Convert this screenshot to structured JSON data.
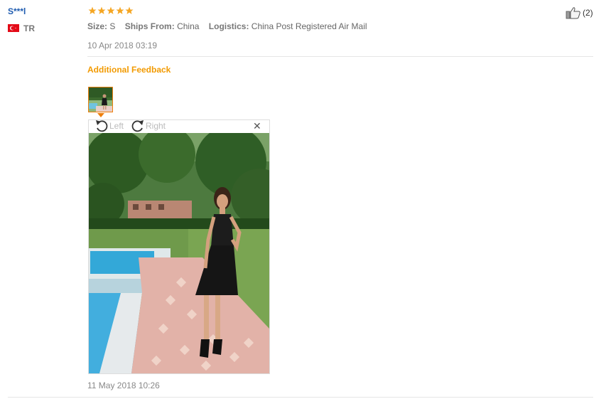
{
  "reviewer": {
    "name": "S***l",
    "country_code": "TR",
    "flag": "turkey-flag"
  },
  "rating": {
    "stars": 5,
    "max": 5,
    "color": "#f5a623"
  },
  "details": [
    {
      "key": "Size:",
      "value": "S"
    },
    {
      "key": "Ships From:",
      "value": "China"
    },
    {
      "key": "Logistics:",
      "value": "China Post Registered Air Mail"
    }
  ],
  "review_date": "10 Apr 2018 03:19",
  "additional_feedback": {
    "title": "Additional Feedback",
    "date": "11 May 2018 10:26"
  },
  "image_viewer": {
    "rotate_left_label": "Left",
    "rotate_right_label": "Right",
    "close_icon": "close-icon"
  },
  "helpful": {
    "icon": "thumbs-up-icon",
    "count": "(2)"
  },
  "colors": {
    "accent": "#f29a00",
    "link": "#1f5cb0",
    "thumb_border": "#ee7e0c"
  }
}
